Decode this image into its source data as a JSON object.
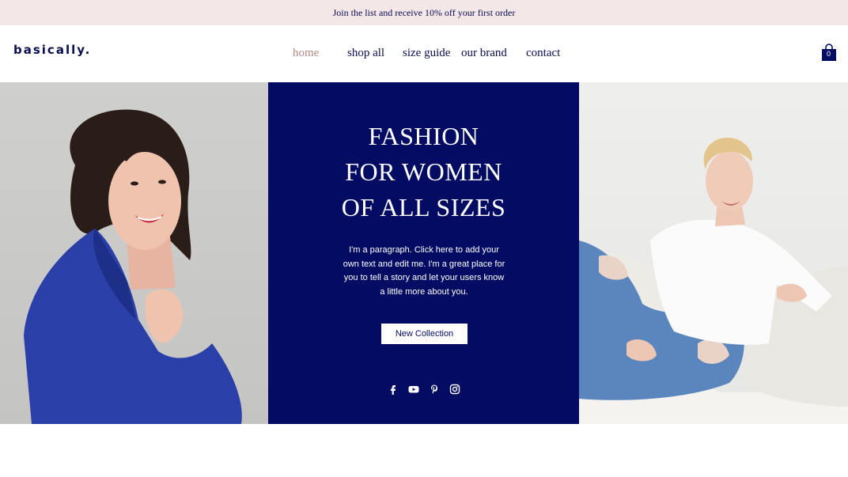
{
  "promo_bar": {
    "text": "Join the list and receive 10% off your first order"
  },
  "header": {
    "logo": "basically.",
    "nav": [
      {
        "label": "home",
        "active": true
      },
      {
        "label": "shop all",
        "active": false
      },
      {
        "label": "size guide",
        "active": false
      },
      {
        "label": "our brand",
        "active": false
      },
      {
        "label": "contact",
        "active": false
      }
    ],
    "cart": {
      "count": "0",
      "icon": "shopping-bag-icon"
    }
  },
  "hero": {
    "headline_lines": [
      "FASHION",
      "FOR WOMEN",
      "OF ALL SIZES"
    ],
    "paragraph": "I'm a paragraph. Click here to add your own text and edit me. I'm a great place for you to tell a story and let your users know a little more about you.",
    "cta_label": "New Collection",
    "social_icons": [
      "facebook-icon",
      "youtube-icon",
      "pinterest-icon",
      "instagram-icon"
    ],
    "left_image": "woman-in-blue-jacket-photo",
    "right_image": "woman-on-sofa-photo"
  },
  "colors": {
    "navy": "#030b63",
    "text_navy": "#0a0e4f",
    "promo_bg": "#f4e7e8",
    "active_nav": "#b08a86",
    "jacket_blue": "#2a3fa8",
    "denim": "#5b86bd"
  }
}
